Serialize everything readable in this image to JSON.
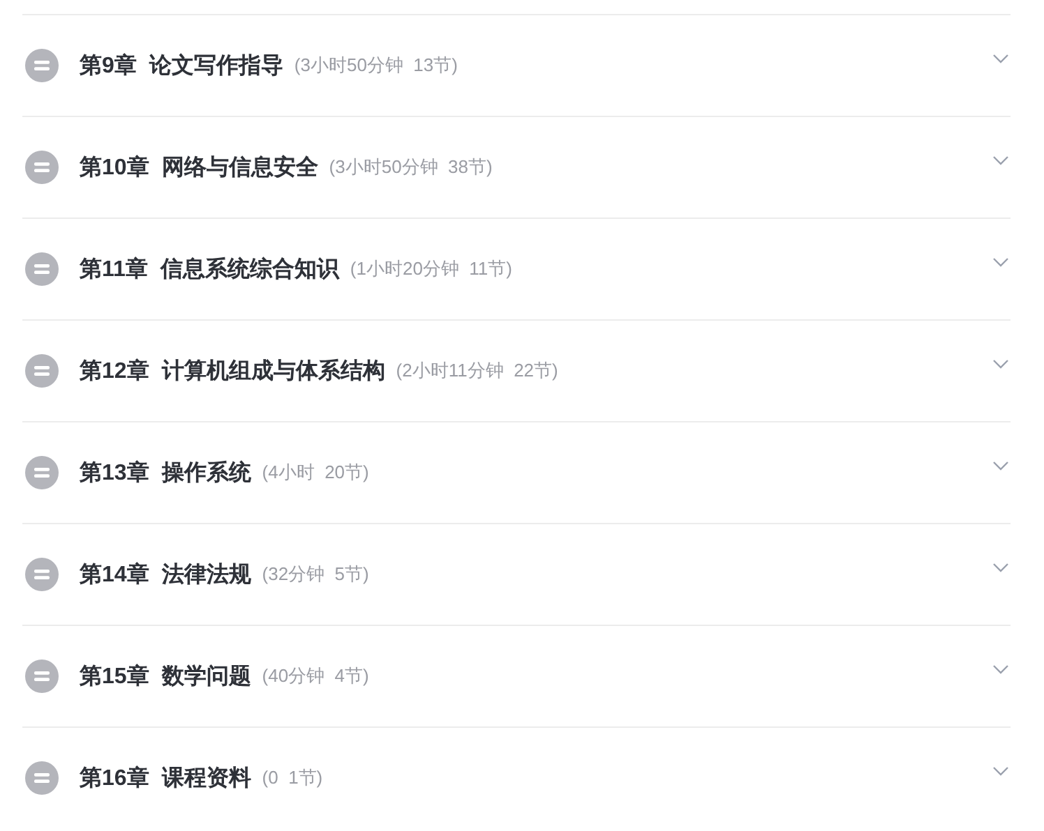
{
  "chapters": [
    {
      "chapter": "第9章",
      "title": "论文写作指导",
      "meta": "(3小时50分钟  13节)",
      "expanded": false
    },
    {
      "chapter": "第10章",
      "title": "网络与信息安全",
      "meta": "(3小时50分钟  38节)",
      "expanded": false
    },
    {
      "chapter": "第11章",
      "title": "信息系统综合知识",
      "meta": "(1小时20分钟  11节)",
      "expanded": false
    },
    {
      "chapter": "第12章",
      "title": "计算机组成与体系结构",
      "meta": "(2小时11分钟  22节)",
      "expanded": false
    },
    {
      "chapter": "第13章",
      "title": "操作系统",
      "meta": "(4小时  20节)",
      "expanded": false
    },
    {
      "chapter": "第14章",
      "title": "法律法规",
      "meta": "(32分钟  5节)",
      "expanded": false
    },
    {
      "chapter": "第15章",
      "title": "数学问题",
      "meta": "(40分钟  4节)",
      "expanded": false
    },
    {
      "chapter": "第16章",
      "title": "课程资料",
      "meta": "(0  1节)",
      "expanded": false
    }
  ]
}
